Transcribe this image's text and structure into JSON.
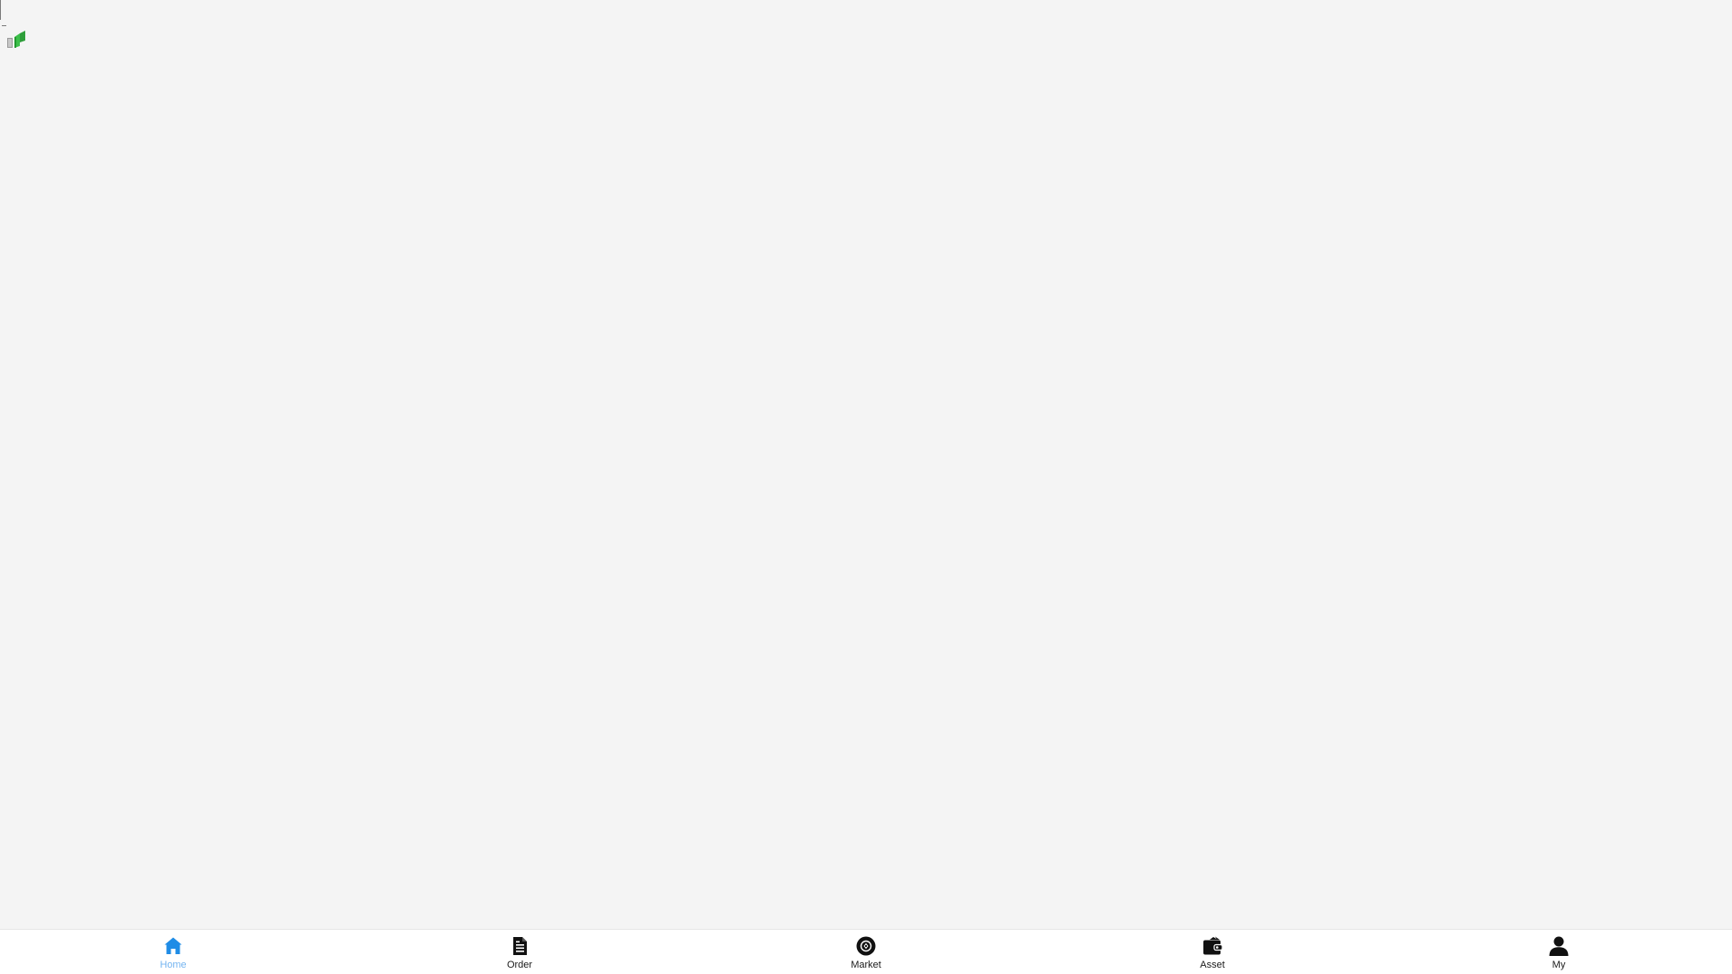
{
  "colors": {
    "background": "#f4f4f4",
    "tabbar_background": "#ffffff",
    "active": "#1f8ce6",
    "active_label": "#74b4f0",
    "inactive": "#111111",
    "logo_green": "#3cbf4a",
    "logo_gray": "#9a9a9a"
  },
  "tabbar": {
    "active_index": 0,
    "tabs": [
      {
        "label": "Home",
        "icon": "home-icon"
      },
      {
        "label": "Order",
        "icon": "document-icon"
      },
      {
        "label": "Market",
        "icon": "market-coin-icon"
      },
      {
        "label": "Asset",
        "icon": "wallet-icon"
      },
      {
        "label": "My",
        "icon": "user-icon"
      }
    ]
  }
}
